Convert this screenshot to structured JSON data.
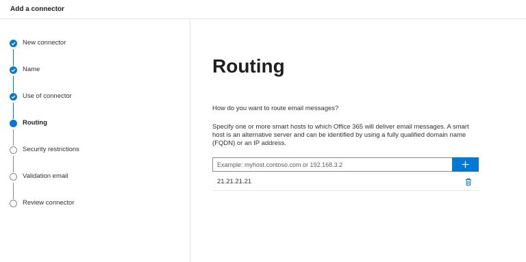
{
  "header": {
    "title": "Add a connector"
  },
  "steps": [
    {
      "label": "New connector",
      "state": "done"
    },
    {
      "label": "Name",
      "state": "done"
    },
    {
      "label": "Use of connector",
      "state": "done"
    },
    {
      "label": "Routing",
      "state": "current"
    },
    {
      "label": "Security restrictions",
      "state": "pending"
    },
    {
      "label": "Validation email",
      "state": "pending"
    },
    {
      "label": "Review connector",
      "state": "pending"
    }
  ],
  "main": {
    "title": "Routing",
    "question": "How do you want to route email messages?",
    "description": "Specify one or more smart hosts to which Office 365 will deliver email messages. A smart host is an alternative server and can be identified by using a fully qualified domain name (FQDN) or an IP address.",
    "input": {
      "placeholder": "Example: myhost.contoso.com or 192.168.3.2",
      "value": ""
    },
    "add_icon": "plus-icon",
    "hosts": [
      {
        "value": "21.21.21.21",
        "delete_icon": "trash-icon"
      }
    ]
  },
  "colors": {
    "accent": "#0078d4",
    "pending": "#8a8886",
    "divider": "#e1dfdd"
  }
}
